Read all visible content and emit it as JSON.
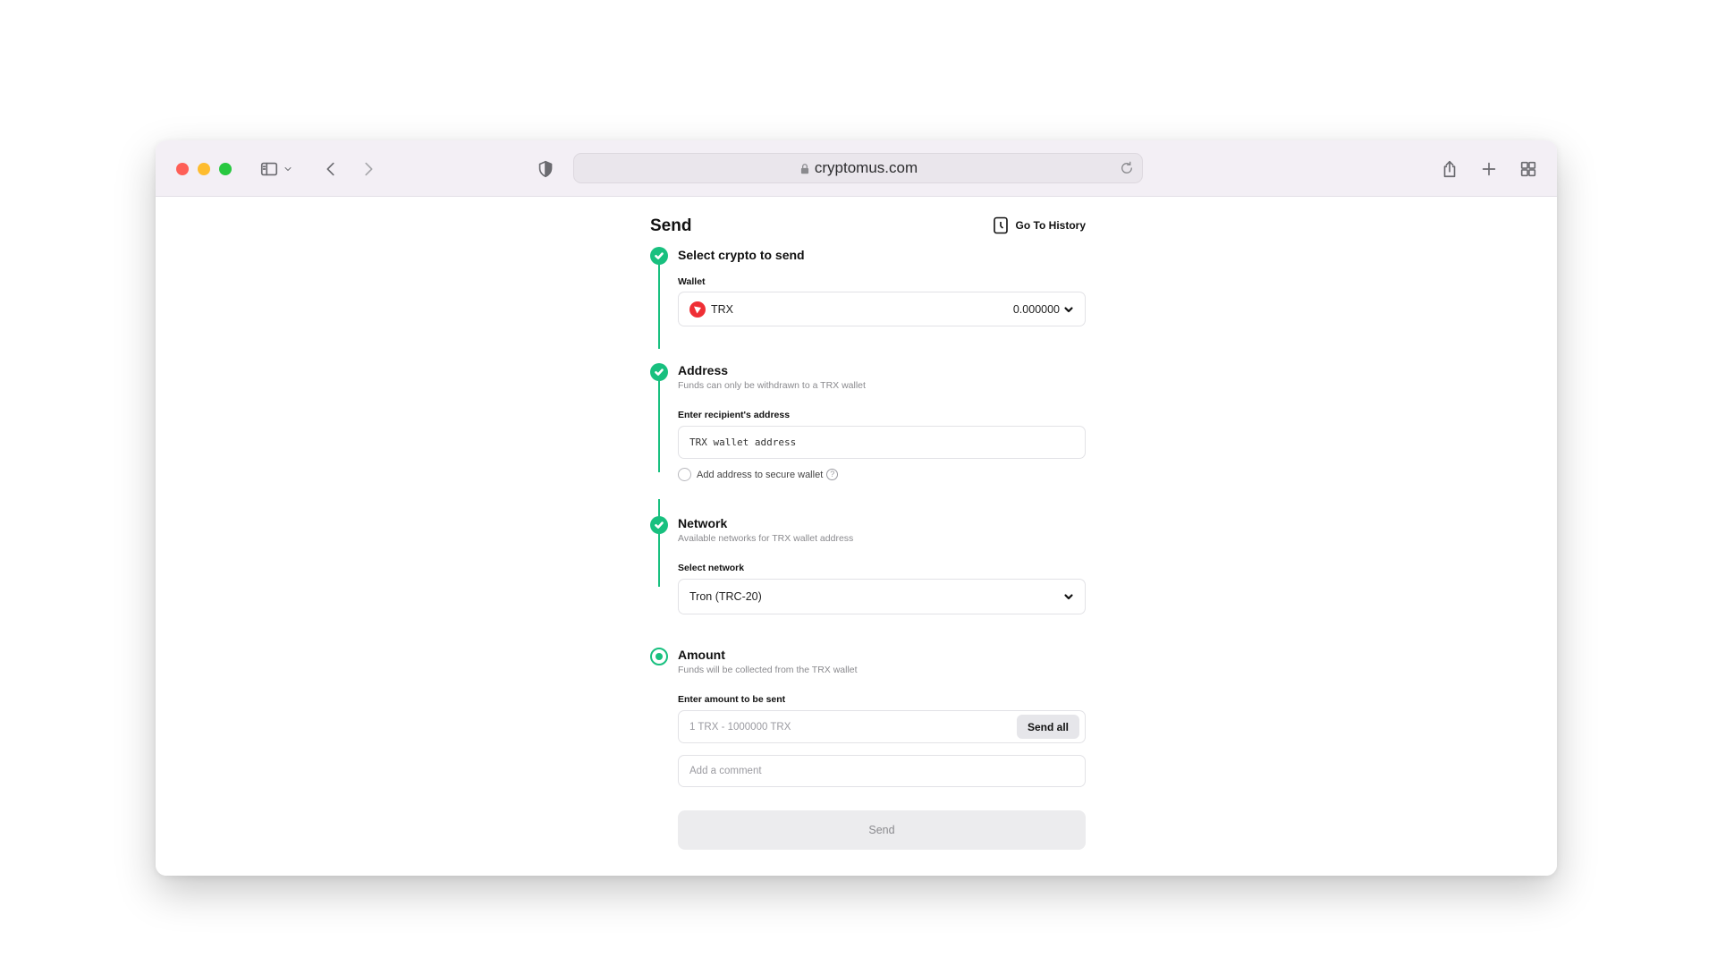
{
  "browser": {
    "url": "cryptomus.com"
  },
  "page": {
    "title": "Send",
    "history_label": "Go To History"
  },
  "steps": {
    "crypto": {
      "title": "Select crypto to send",
      "wallet_label": "Wallet",
      "wallet_currency": "TRX",
      "wallet_balance": "0.000000"
    },
    "address": {
      "title": "Address",
      "subtitle": "Funds can only be withdrawn to a TRX wallet",
      "field_label": "Enter recipient's address",
      "placeholder": "TRX wallet address",
      "secure_label": "Add address to secure wallet",
      "info_glyph": "?"
    },
    "network": {
      "title": "Network",
      "subtitle": "Available networks for TRX wallet address",
      "field_label": "Select network",
      "selected": "Tron (TRC-20)"
    },
    "amount": {
      "title": "Amount",
      "subtitle": "Funds will be collected from the TRX wallet",
      "field_label": "Enter amount to be sent",
      "placeholder": "1 TRX - 1000000 TRX",
      "send_all_label": "Send all",
      "comment_placeholder": "Add a comment"
    }
  },
  "submit": {
    "label": "Send"
  },
  "colors": {
    "accent": "#18c07f",
    "trx": "#ef2f35"
  }
}
